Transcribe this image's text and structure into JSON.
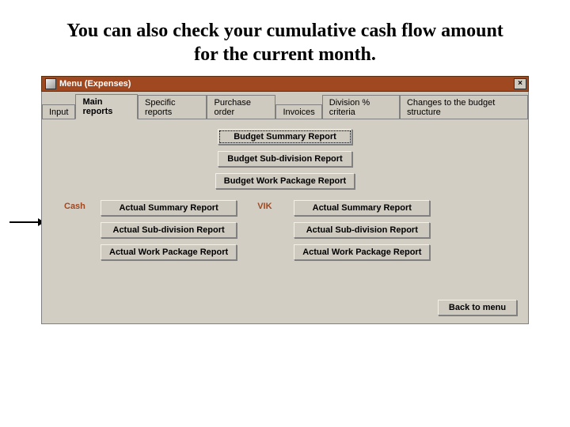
{
  "slide": {
    "title": "You can also check your cumulative cash flow amount for the current month."
  },
  "window": {
    "title": "Menu (Expenses)"
  },
  "tabs": [
    {
      "label": "Input"
    },
    {
      "label": "Main reports"
    },
    {
      "label": "Specific reports"
    },
    {
      "label": "Purchase order"
    },
    {
      "label": "Invoices"
    },
    {
      "label": "Division % criteria"
    },
    {
      "label": "Changes to the budget structure"
    }
  ],
  "top_buttons": {
    "budget_summary": "Budget Summary Report",
    "budget_subdivision": "Budget Sub-division Report",
    "budget_workpackage": "Budget Work Package Report"
  },
  "cash": {
    "heading": "Cash",
    "actual_summary": "Actual Summary Report",
    "actual_subdivision": "Actual Sub-division Report",
    "actual_workpackage": "Actual Work Package Report"
  },
  "vik": {
    "heading": "VIK",
    "actual_summary": "Actual Summary Report",
    "actual_subdivision": "Actual Sub-division Report",
    "actual_workpackage": "Actual Work Package Report"
  },
  "footer": {
    "back": "Back to menu"
  }
}
